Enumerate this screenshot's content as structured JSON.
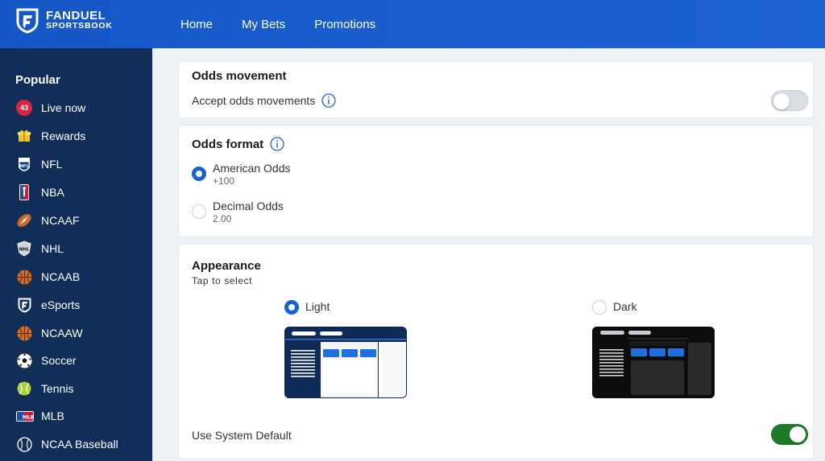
{
  "brand": {
    "line1": "FANDUEL",
    "line2": "SPORTSBOOK"
  },
  "nav": [
    "Home",
    "My Bets",
    "Promotions"
  ],
  "sidebar": {
    "title": "Popular",
    "live_count": "43",
    "items": [
      {
        "label": "Live now",
        "icon": "live-badge"
      },
      {
        "label": "Rewards",
        "icon": "gift-icon"
      },
      {
        "label": "NFL",
        "icon": "nfl-icon"
      },
      {
        "label": "NBA",
        "icon": "nba-icon"
      },
      {
        "label": "NCAAF",
        "icon": "football-icon"
      },
      {
        "label": "NHL",
        "icon": "nhl-icon"
      },
      {
        "label": "NCAAB",
        "icon": "basketball-icon"
      },
      {
        "label": "eSports",
        "icon": "fanduel-shield-icon"
      },
      {
        "label": "NCAAW",
        "icon": "basketball-icon"
      },
      {
        "label": "Soccer",
        "icon": "soccer-ball-icon"
      },
      {
        "label": "Tennis",
        "icon": "tennis-ball-icon"
      },
      {
        "label": "MLB",
        "icon": "mlb-icon"
      },
      {
        "label": "NCAA Baseball",
        "icon": "baseball-icon"
      }
    ]
  },
  "odds_movement": {
    "title": "Odds movement",
    "accept_label": "Accept odds movements",
    "accept_enabled": false
  },
  "odds_format": {
    "title": "Odds format",
    "options": [
      {
        "label": "American Odds",
        "example": "+100",
        "selected": true
      },
      {
        "label": "Decimal Odds",
        "example": "2.00",
        "selected": false
      }
    ]
  },
  "appearance": {
    "title": "Appearance",
    "subtitle": "Tap to select",
    "options": [
      {
        "label": "Light",
        "selected": true
      },
      {
        "label": "Dark",
        "selected": false
      }
    ],
    "system_default_label": "Use System Default",
    "system_default_enabled": true
  },
  "colors": {
    "header_blue": "#1b5fd0",
    "sidebar_navy": "#112e59",
    "radio_blue": "#1762d1",
    "toggle_green": "#1e7a28"
  }
}
